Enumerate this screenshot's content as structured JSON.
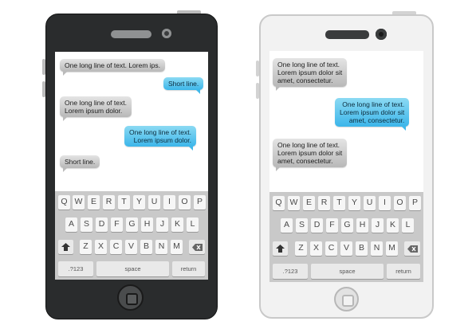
{
  "phones": [
    {
      "theme": "dark",
      "body_color": "#2a2c2d",
      "messages": [
        {
          "from": "received",
          "lines": [
            "One long line of text. Lorem ips."
          ]
        },
        {
          "from": "sent",
          "lines": [
            "Short line."
          ]
        },
        {
          "from": "received",
          "lines": [
            "One long line of text.",
            "Lorem ipsum dolor."
          ]
        },
        {
          "from": "sent",
          "lines": [
            "One long line of text.",
            "Lorem ipsum dolor."
          ]
        },
        {
          "from": "received",
          "lines": [
            "Short line."
          ]
        }
      ]
    },
    {
      "theme": "light",
      "body_color": "#f2f2f2",
      "messages": [
        {
          "from": "received",
          "lines": [
            "One long line of text.",
            "Lorem ipsum dolor sit",
            "amet, consectetur."
          ]
        },
        {
          "from": "sent",
          "lines": [
            "One long line of text.",
            "Lorem ipsum dolor sit",
            "amet, consectetur."
          ]
        },
        {
          "from": "received",
          "lines": [
            "One long line of text.",
            "Lorem ipsum dolor sit",
            "amet, consectetur."
          ]
        }
      ]
    }
  ],
  "keyboard": {
    "row1": [
      "Q",
      "W",
      "E",
      "R",
      "T",
      "Y",
      "U",
      "I",
      "O",
      "P"
    ],
    "row2": [
      "A",
      "S",
      "D",
      "F",
      "G",
      "H",
      "J",
      "K",
      "L"
    ],
    "row3": [
      "Z",
      "X",
      "C",
      "V",
      "B",
      "N",
      "M"
    ],
    "shift_icon": "shift-arrow-icon",
    "backspace_icon": "backspace-icon",
    "numbers_label": ".?123",
    "space_label": "space",
    "return_label": "return"
  },
  "colors": {
    "sent_bubble": "#3cb6ea",
    "received_bubble": "#c8c8c8",
    "keyboard_bg": "#c9c9c9"
  }
}
